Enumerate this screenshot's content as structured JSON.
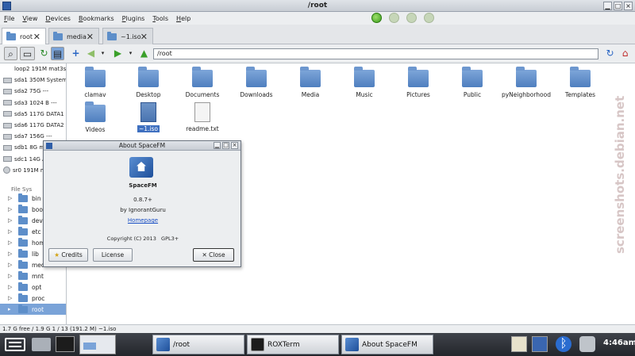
{
  "window": {
    "title": "/root"
  },
  "menu": [
    "File",
    "View",
    "Devices",
    "Bookmarks",
    "Plugins",
    "Tools",
    "Help"
  ],
  "tabs": [
    {
      "label": "root"
    },
    {
      "label": "media"
    },
    {
      "label": "~1.iso"
    }
  ],
  "pathbar": {
    "value": "/root"
  },
  "devices": [
    "loop2 191M mat3sr",
    "sda1 350M System R",
    "sda2 75G ---",
    "sda3 1024 B ---",
    "sda5 117G DATA1 ---",
    "sda6 117G DATA2 ---",
    "sda7 156G ---",
    "sdb1 8G m",
    "sdc1 14G A",
    "sr0 191M m"
  ],
  "tree": {
    "header": "File Sys",
    "items": [
      "bin",
      "boot",
      "dev",
      "etc",
      "hom",
      "lib",
      "medi",
      "mnt",
      "opt",
      "proc",
      "root"
    ]
  },
  "files": [
    {
      "name": "clamav",
      "kind": "folder"
    },
    {
      "name": "Desktop",
      "kind": "folder"
    },
    {
      "name": "Documents",
      "kind": "folder"
    },
    {
      "name": "Downloads",
      "kind": "folder"
    },
    {
      "name": "Media",
      "kind": "folder"
    },
    {
      "name": "Music",
      "kind": "folder"
    },
    {
      "name": "Pictures",
      "kind": "folder"
    },
    {
      "name": "Public",
      "kind": "folder"
    },
    {
      "name": "pyNeighborhood",
      "kind": "folder"
    },
    {
      "name": "Templates",
      "kind": "folder"
    },
    {
      "name": "Videos",
      "kind": "folder"
    },
    {
      "name": "~1.iso",
      "kind": "iso"
    },
    {
      "name": "readme.txt",
      "kind": "doc"
    }
  ],
  "about": {
    "title": "About SpaceFM",
    "app_name": "SpaceFM",
    "version": "0.8.7+",
    "author": "by IgnorantGuru",
    "homepage": "Homepage",
    "copyright": "Copyright (C) 2013",
    "license_text": "GPL3+",
    "credits_label": "Credits",
    "license_label": "License",
    "close_label": "Close"
  },
  "statusbar": {
    "text": "1.7 G free / 1.9 G    1 / 13 (191.2 M)    ~1.iso"
  },
  "taskbar": {
    "tasks": [
      "/root",
      "ROXTerm",
      "About SpaceFM"
    ],
    "clock": "4:46am"
  },
  "watermark": "screenshots.debian.net"
}
